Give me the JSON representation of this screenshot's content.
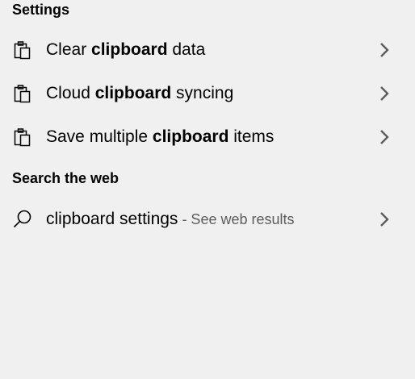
{
  "sections": {
    "settings_header": "Settings",
    "web_header": "Search the web"
  },
  "settings_items": [
    {
      "prefix": "Clear ",
      "bold": "clipboard",
      "suffix": " data",
      "icon": "clipboard-icon"
    },
    {
      "prefix": "Cloud ",
      "bold": "clipboard",
      "suffix": " syncing",
      "icon": "clipboard-icon"
    },
    {
      "prefix": "Save multiple ",
      "bold": "clipboard",
      "suffix": " items",
      "icon": "clipboard-icon"
    }
  ],
  "web_item": {
    "query": "clipboard settings",
    "hint": " - See web results",
    "icon": "search-icon"
  },
  "colors": {
    "background": "#f0f0f0",
    "text": "#000000",
    "hint": "#5d5d5d",
    "chevron": "#5d5d5d"
  }
}
